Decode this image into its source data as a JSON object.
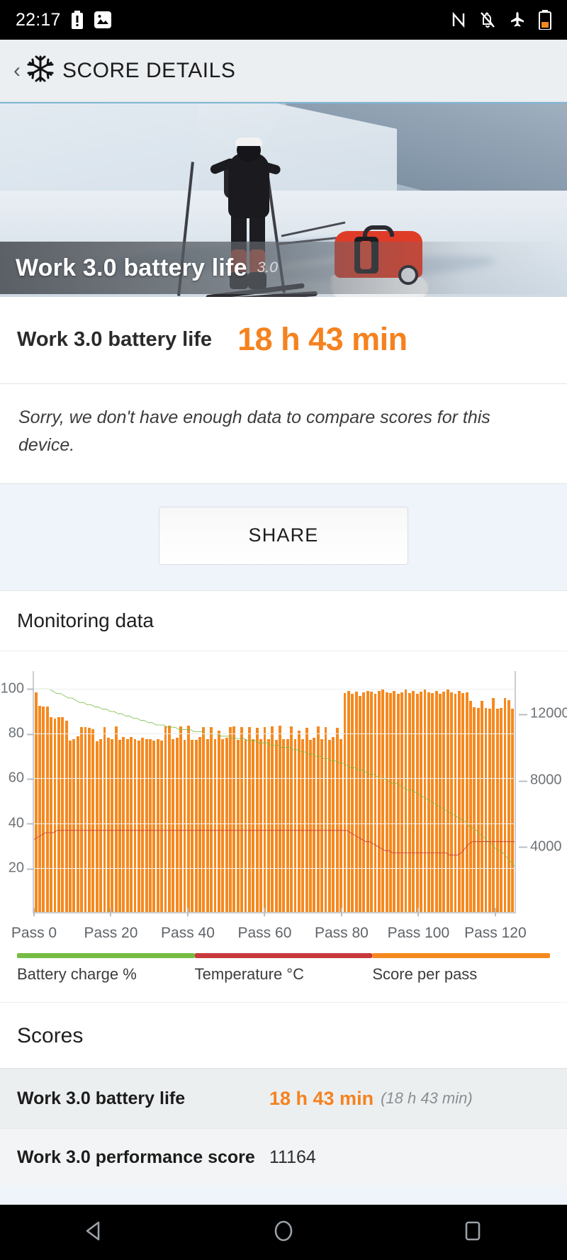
{
  "status_bar": {
    "time": "22:17",
    "left_icons": [
      "battery-alert-icon",
      "image-icon"
    ],
    "right_icons": [
      "nfc-icon",
      "notifications-off-icon",
      "airplane-mode-icon",
      "battery-icon"
    ]
  },
  "app_bar": {
    "back_label": "‹",
    "logo": "snowflake-icon",
    "title": "SCORE DETAILS"
  },
  "hero": {
    "caption_title": "Work 3.0 battery life",
    "caption_version": "3.0",
    "image_alt": "skier-pulling-sled-photo"
  },
  "score_header": {
    "label": "Work 3.0 battery life",
    "value": "18 h 43 min"
  },
  "notice": {
    "text": "Sorry, we don't have enough data to compare scores for this device."
  },
  "share": {
    "label": "SHARE"
  },
  "monitoring": {
    "title": "Monitoring data",
    "legend": [
      {
        "label": "Battery charge %",
        "color": "#76bc43"
      },
      {
        "label": "Temperature °C",
        "color": "#c8393c"
      },
      {
        "label": "Score per pass",
        "color": "#f5891f"
      }
    ]
  },
  "scores_section": {
    "title": "Scores",
    "rows": [
      {
        "label": "Work 3.0 battery life",
        "value": "18 h 43 min",
        "sub": "(18 h 43 min)",
        "accent": true
      },
      {
        "label": "Work 3.0 performance score",
        "value": "11164",
        "sub": "",
        "accent": false
      }
    ]
  },
  "nav_bar": {
    "items": [
      "back-triangle-icon",
      "home-circle-icon",
      "recents-square-icon"
    ]
  },
  "chart_data": {
    "type": "bar",
    "title": "Monitoring data",
    "xlabel": "",
    "ylabel": "",
    "x_ticks": [
      "Pass 0",
      "Pass 20",
      "Pass 40",
      "Pass 60",
      "Pass 80",
      "Pass 100",
      "Pass 120"
    ],
    "x_tick_values": [
      0,
      20,
      40,
      60,
      80,
      100,
      120
    ],
    "left_axis": {
      "label": "Battery charge % / Temperature °C",
      "ticks": [
        20,
        40,
        60,
        80,
        100
      ],
      "range": [
        0,
        108
      ]
    },
    "right_axis": {
      "label": "Score per pass",
      "ticks": [
        4000,
        8000,
        12000
      ],
      "range": [
        0,
        14600
      ]
    },
    "grid": true,
    "legend_position": "bottom",
    "series": [
      {
        "name": "Score per pass",
        "type": "bar",
        "color": "#f5891f",
        "axis": "right",
        "values": [
          13300,
          12500,
          12450,
          12450,
          11800,
          11700,
          11800,
          11800,
          11600,
          10400,
          10500,
          10650,
          11200,
          11200,
          11150,
          11100,
          10350,
          10500,
          11200,
          10550,
          10500,
          11250,
          10450,
          10600,
          10500,
          10600,
          10500,
          10400,
          10550,
          10500,
          10500,
          10400,
          10500,
          10400,
          11250,
          11300,
          10500,
          10550,
          11250,
          10450,
          11300,
          10450,
          10450,
          10600,
          11200,
          10500,
          11200,
          10500,
          11000,
          10500,
          10550,
          11200,
          11250,
          10450,
          11200,
          10500,
          11200,
          10500,
          11150,
          10500,
          11200,
          10500,
          11250,
          10450,
          11300,
          10500,
          10500,
          11250,
          10500,
          11000,
          10500,
          11150,
          10450,
          10550,
          11250,
          10500,
          11200,
          10450,
          10600,
          11150,
          10500,
          13250,
          13400,
          13200,
          13350,
          13100,
          13300,
          13400,
          13350,
          13200,
          13400,
          13500,
          13300,
          13250,
          13400,
          13200,
          13300,
          13450,
          13250,
          13400,
          13200,
          13350,
          13450,
          13300,
          13250,
          13400,
          13200,
          13350,
          13450,
          13300,
          13200,
          13400,
          13250,
          13300,
          12800,
          12400,
          12350,
          12800,
          12350,
          12300,
          12950,
          12300,
          12350,
          12950,
          12850,
          12300
        ],
        "count": 127
      },
      {
        "name": "Battery charge %",
        "type": "line",
        "color": "#76bc43",
        "axis": "left",
        "values": [
          100,
          100,
          100,
          100,
          100,
          99,
          98,
          98,
          97,
          96,
          96,
          95,
          94,
          94,
          93,
          93,
          92,
          92,
          91,
          91,
          90,
          90,
          89,
          89,
          88,
          88,
          87,
          87,
          86,
          86,
          85,
          85,
          84,
          84,
          84,
          83,
          83,
          83,
          82,
          82,
          82,
          82,
          81,
          81,
          81,
          80,
          80,
          80,
          80,
          79,
          79,
          79,
          78,
          78,
          78,
          78,
          77,
          77,
          77,
          76,
          76,
          76,
          75,
          75,
          75,
          74,
          74,
          74,
          73,
          73,
          72,
          72,
          71,
          71,
          70,
          70,
          69,
          69,
          68,
          68,
          67,
          67,
          66,
          65,
          65,
          64,
          64,
          63,
          62,
          62,
          61,
          60,
          60,
          59,
          58,
          58,
          57,
          56,
          55,
          55,
          54,
          53,
          52,
          51,
          50,
          49,
          48,
          47,
          46,
          45,
          44,
          43,
          42,
          41,
          39,
          38,
          37,
          35,
          34,
          32,
          31,
          29,
          28,
          27,
          25,
          23,
          21
        ]
      },
      {
        "name": "Temperature °C",
        "type": "line",
        "color": "#c8393c",
        "axis": "left",
        "values": [
          33,
          34,
          35,
          36,
          36,
          36,
          37,
          37,
          37,
          37,
          37,
          37,
          37,
          37,
          37,
          37,
          37,
          37,
          37,
          37,
          37,
          37,
          37,
          37,
          37,
          37,
          37,
          37,
          37,
          37,
          37,
          37,
          37,
          37,
          37,
          37,
          37,
          37,
          37,
          37,
          37,
          37,
          37,
          37,
          37,
          37,
          37,
          37,
          37,
          37,
          37,
          37,
          37,
          37,
          37,
          37,
          37,
          37,
          37,
          37,
          37,
          37,
          37,
          37,
          37,
          37,
          37,
          37,
          37,
          37,
          37,
          37,
          37,
          37,
          37,
          37,
          37,
          37,
          37,
          37,
          37,
          37,
          37,
          36,
          35,
          34,
          33,
          32,
          32,
          31,
          30,
          29,
          28,
          28,
          27,
          27,
          27,
          27,
          27,
          27,
          27,
          27,
          27,
          27,
          27,
          27,
          27,
          27,
          27,
          26,
          26,
          26,
          27,
          29,
          31,
          32,
          32,
          32,
          32,
          32,
          32,
          32,
          32,
          32,
          32,
          32,
          32
        ]
      }
    ]
  }
}
